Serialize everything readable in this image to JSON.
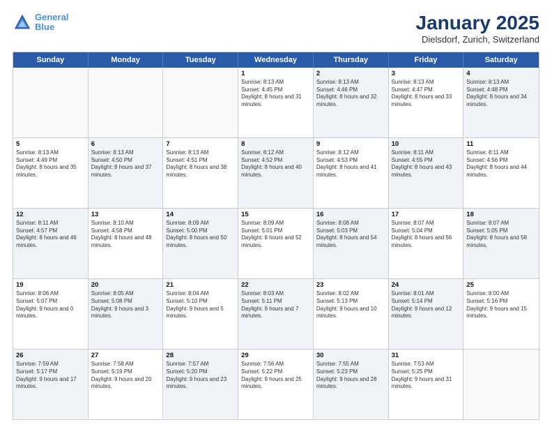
{
  "header": {
    "logo_line1": "General",
    "logo_line2": "Blue",
    "title": "January 2025",
    "subtitle": "Dielsdorf, Zurich, Switzerland"
  },
  "weekdays": [
    "Sunday",
    "Monday",
    "Tuesday",
    "Wednesday",
    "Thursday",
    "Friday",
    "Saturday"
  ],
  "weeks": [
    [
      {
        "day": "",
        "sunrise": "",
        "sunset": "",
        "daylight": "",
        "shaded": false,
        "empty": true
      },
      {
        "day": "",
        "sunrise": "",
        "sunset": "",
        "daylight": "",
        "shaded": false,
        "empty": true
      },
      {
        "day": "",
        "sunrise": "",
        "sunset": "",
        "daylight": "",
        "shaded": false,
        "empty": true
      },
      {
        "day": "1",
        "sunrise": "Sunrise: 8:13 AM",
        "sunset": "Sunset: 4:45 PM",
        "daylight": "Daylight: 8 hours and 31 minutes.",
        "shaded": false,
        "empty": false
      },
      {
        "day": "2",
        "sunrise": "Sunrise: 8:13 AM",
        "sunset": "Sunset: 4:46 PM",
        "daylight": "Daylight: 8 hours and 32 minutes.",
        "shaded": true,
        "empty": false
      },
      {
        "day": "3",
        "sunrise": "Sunrise: 8:13 AM",
        "sunset": "Sunset: 4:47 PM",
        "daylight": "Daylight: 8 hours and 33 minutes.",
        "shaded": false,
        "empty": false
      },
      {
        "day": "4",
        "sunrise": "Sunrise: 8:13 AM",
        "sunset": "Sunset: 4:48 PM",
        "daylight": "Daylight: 8 hours and 34 minutes.",
        "shaded": true,
        "empty": false
      }
    ],
    [
      {
        "day": "5",
        "sunrise": "Sunrise: 8:13 AM",
        "sunset": "Sunset: 4:49 PM",
        "daylight": "Daylight: 8 hours and 35 minutes.",
        "shaded": false,
        "empty": false
      },
      {
        "day": "6",
        "sunrise": "Sunrise: 8:13 AM",
        "sunset": "Sunset: 4:50 PM",
        "daylight": "Daylight: 8 hours and 37 minutes.",
        "shaded": true,
        "empty": false
      },
      {
        "day": "7",
        "sunrise": "Sunrise: 8:13 AM",
        "sunset": "Sunset: 4:51 PM",
        "daylight": "Daylight: 8 hours and 38 minutes.",
        "shaded": false,
        "empty": false
      },
      {
        "day": "8",
        "sunrise": "Sunrise: 8:12 AM",
        "sunset": "Sunset: 4:52 PM",
        "daylight": "Daylight: 8 hours and 40 minutes.",
        "shaded": true,
        "empty": false
      },
      {
        "day": "9",
        "sunrise": "Sunrise: 8:12 AM",
        "sunset": "Sunset: 4:53 PM",
        "daylight": "Daylight: 8 hours and 41 minutes.",
        "shaded": false,
        "empty": false
      },
      {
        "day": "10",
        "sunrise": "Sunrise: 8:11 AM",
        "sunset": "Sunset: 4:55 PM",
        "daylight": "Daylight: 8 hours and 43 minutes.",
        "shaded": true,
        "empty": false
      },
      {
        "day": "11",
        "sunrise": "Sunrise: 8:11 AM",
        "sunset": "Sunset: 4:56 PM",
        "daylight": "Daylight: 8 hours and 44 minutes.",
        "shaded": false,
        "empty": false
      }
    ],
    [
      {
        "day": "12",
        "sunrise": "Sunrise: 8:11 AM",
        "sunset": "Sunset: 4:57 PM",
        "daylight": "Daylight: 8 hours and 46 minutes.",
        "shaded": true,
        "empty": false
      },
      {
        "day": "13",
        "sunrise": "Sunrise: 8:10 AM",
        "sunset": "Sunset: 4:58 PM",
        "daylight": "Daylight: 8 hours and 48 minutes.",
        "shaded": false,
        "empty": false
      },
      {
        "day": "14",
        "sunrise": "Sunrise: 8:09 AM",
        "sunset": "Sunset: 5:00 PM",
        "daylight": "Daylight: 8 hours and 50 minutes.",
        "shaded": true,
        "empty": false
      },
      {
        "day": "15",
        "sunrise": "Sunrise: 8:09 AM",
        "sunset": "Sunset: 5:01 PM",
        "daylight": "Daylight: 8 hours and 52 minutes.",
        "shaded": false,
        "empty": false
      },
      {
        "day": "16",
        "sunrise": "Sunrise: 8:08 AM",
        "sunset": "Sunset: 5:03 PM",
        "daylight": "Daylight: 8 hours and 54 minutes.",
        "shaded": true,
        "empty": false
      },
      {
        "day": "17",
        "sunrise": "Sunrise: 8:07 AM",
        "sunset": "Sunset: 5:04 PM",
        "daylight": "Daylight: 8 hours and 56 minutes.",
        "shaded": false,
        "empty": false
      },
      {
        "day": "18",
        "sunrise": "Sunrise: 8:07 AM",
        "sunset": "Sunset: 5:05 PM",
        "daylight": "Daylight: 8 hours and 58 minutes.",
        "shaded": true,
        "empty": false
      }
    ],
    [
      {
        "day": "19",
        "sunrise": "Sunrise: 8:06 AM",
        "sunset": "Sunset: 5:07 PM",
        "daylight": "Daylight: 9 hours and 0 minutes.",
        "shaded": false,
        "empty": false
      },
      {
        "day": "20",
        "sunrise": "Sunrise: 8:05 AM",
        "sunset": "Sunset: 5:08 PM",
        "daylight": "Daylight: 9 hours and 3 minutes.",
        "shaded": true,
        "empty": false
      },
      {
        "day": "21",
        "sunrise": "Sunrise: 8:04 AM",
        "sunset": "Sunset: 5:10 PM",
        "daylight": "Daylight: 9 hours and 5 minutes.",
        "shaded": false,
        "empty": false
      },
      {
        "day": "22",
        "sunrise": "Sunrise: 8:03 AM",
        "sunset": "Sunset: 5:11 PM",
        "daylight": "Daylight: 9 hours and 7 minutes.",
        "shaded": true,
        "empty": false
      },
      {
        "day": "23",
        "sunrise": "Sunrise: 8:02 AM",
        "sunset": "Sunset: 5:13 PM",
        "daylight": "Daylight: 9 hours and 10 minutes.",
        "shaded": false,
        "empty": false
      },
      {
        "day": "24",
        "sunrise": "Sunrise: 8:01 AM",
        "sunset": "Sunset: 5:14 PM",
        "daylight": "Daylight: 9 hours and 12 minutes.",
        "shaded": true,
        "empty": false
      },
      {
        "day": "25",
        "sunrise": "Sunrise: 8:00 AM",
        "sunset": "Sunset: 5:16 PM",
        "daylight": "Daylight: 9 hours and 15 minutes.",
        "shaded": false,
        "empty": false
      }
    ],
    [
      {
        "day": "26",
        "sunrise": "Sunrise: 7:59 AM",
        "sunset": "Sunset: 5:17 PM",
        "daylight": "Daylight: 9 hours and 17 minutes.",
        "shaded": true,
        "empty": false
      },
      {
        "day": "27",
        "sunrise": "Sunrise: 7:58 AM",
        "sunset": "Sunset: 5:19 PM",
        "daylight": "Daylight: 9 hours and 20 minutes.",
        "shaded": false,
        "empty": false
      },
      {
        "day": "28",
        "sunrise": "Sunrise: 7:57 AM",
        "sunset": "Sunset: 5:20 PM",
        "daylight": "Daylight: 9 hours and 23 minutes.",
        "shaded": true,
        "empty": false
      },
      {
        "day": "29",
        "sunrise": "Sunrise: 7:56 AM",
        "sunset": "Sunset: 5:22 PM",
        "daylight": "Daylight: 9 hours and 25 minutes.",
        "shaded": false,
        "empty": false
      },
      {
        "day": "30",
        "sunrise": "Sunrise: 7:55 AM",
        "sunset": "Sunset: 5:23 PM",
        "daylight": "Daylight: 9 hours and 28 minutes.",
        "shaded": true,
        "empty": false
      },
      {
        "day": "31",
        "sunrise": "Sunrise: 7:53 AM",
        "sunset": "Sunset: 5:25 PM",
        "daylight": "Daylight: 9 hours and 31 minutes.",
        "shaded": false,
        "empty": false
      },
      {
        "day": "",
        "sunrise": "",
        "sunset": "",
        "daylight": "",
        "shaded": true,
        "empty": true
      }
    ]
  ]
}
